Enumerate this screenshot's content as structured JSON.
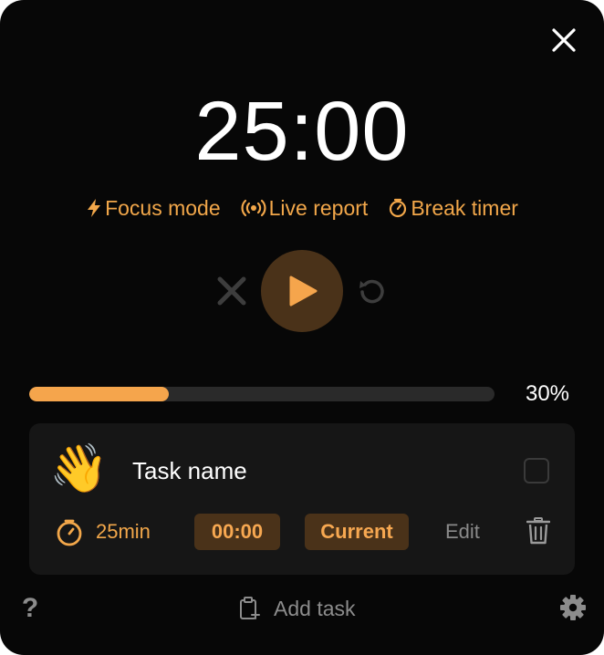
{
  "timer": {
    "display": "25:00"
  },
  "modes": [
    {
      "label": "Focus mode",
      "icon": "lightning-icon"
    },
    {
      "label": "Live report",
      "icon": "broadcast-icon"
    },
    {
      "label": "Break timer",
      "icon": "stopwatch-icon"
    }
  ],
  "controls": {
    "stop_icon": "close-icon",
    "play_icon": "play-icon",
    "reset_icon": "reset-icon"
  },
  "progress": {
    "percent": 30,
    "label": "30%"
  },
  "task": {
    "emoji": "👋",
    "name": "Task name",
    "duration": "25min",
    "elapsed": "00:00",
    "status": "Current",
    "edit_label": "Edit"
  },
  "footer": {
    "help_label": "?",
    "add_task_label": "Add task"
  },
  "colors": {
    "accent": "#f2a74a",
    "background": "#070707",
    "card": "#161616",
    "badge": "#4a3219",
    "track": "#2a2a2a",
    "muted": "#8c8c8c"
  }
}
